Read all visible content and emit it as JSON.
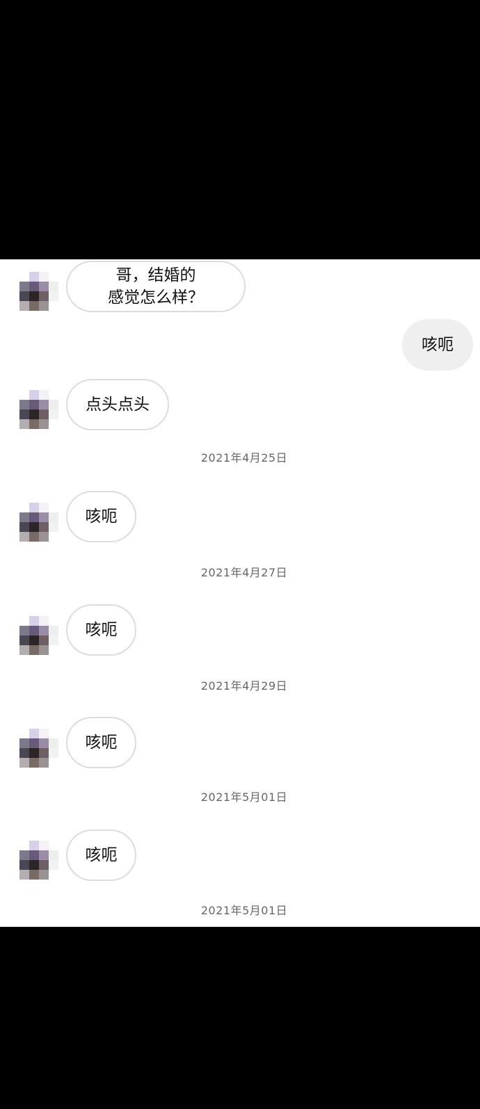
{
  "colors": {
    "background": "#000000",
    "chat_background": "#ffffff",
    "incoming_bubble_border": "#dcdcdc",
    "outgoing_bubble_fill": "#efefef",
    "timestamp_text": "#666666"
  },
  "avatar_palette": [
    [
      "#ffffff",
      "#d8d0e8",
      "#f4f2f6",
      "#ffffff"
    ],
    [
      "#7c7a8a",
      "#6a5a7a",
      "#9b8ca8",
      "#eeeeee"
    ],
    [
      "#4a4654",
      "#2c2528",
      "#6e6064",
      "#f2f2f2"
    ],
    [
      "#b4aeb2",
      "#7a6a66",
      "#9a9294",
      "#ffffff"
    ]
  ],
  "messages": [
    {
      "sender": "other",
      "text": "哥，结婚的\n感觉怎么样？"
    },
    {
      "sender": "self",
      "text": "咳呃"
    },
    {
      "sender": "other",
      "text": "点头点头"
    },
    {
      "type": "timestamp",
      "text": "2021年4月25日"
    },
    {
      "sender": "other",
      "text": "咳呃"
    },
    {
      "type": "timestamp",
      "text": "2021年4月27日"
    },
    {
      "sender": "other",
      "text": "咳呃"
    },
    {
      "type": "timestamp",
      "text": "2021年4月29日"
    },
    {
      "sender": "other",
      "text": "咳呃"
    },
    {
      "type": "timestamp",
      "text": "2021年5月01日"
    },
    {
      "sender": "other",
      "text": "咳呃"
    },
    {
      "type": "timestamp",
      "text": "2021年5月01日"
    }
  ]
}
